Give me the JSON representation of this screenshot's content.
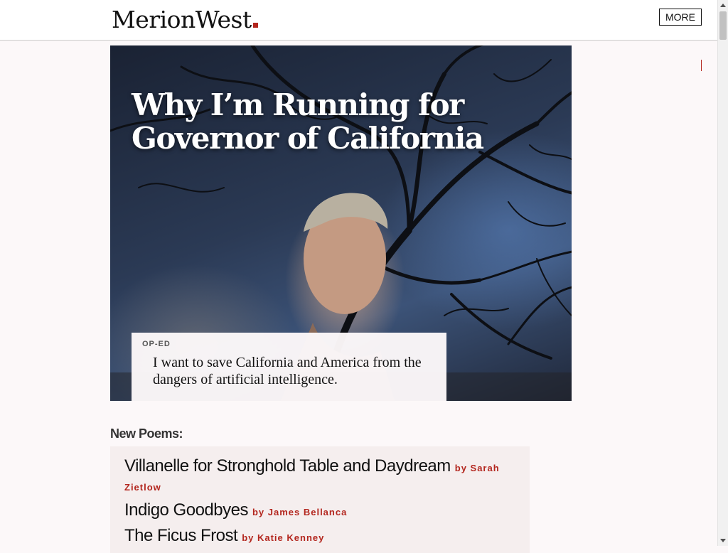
{
  "header": {
    "logo_text": "MerionWest",
    "more_label": "MORE",
    "accent_color": "#b3261e"
  },
  "hero": {
    "title": "Why I’m Running for Governor of California",
    "category": "OP-ED",
    "dek": "I want to save California and America from the dangers of artificial intelligence."
  },
  "poems": {
    "heading": "New Poems:",
    "items": [
      {
        "title": "Villanelle for Stronghold Table and Daydream",
        "byline": "by Sarah Zietlow"
      },
      {
        "title": "Indigo Goodbyes",
        "byline": "by James Bellanca"
      },
      {
        "title": "The Ficus Frost",
        "byline": "by Katie Kenney"
      }
    ]
  }
}
